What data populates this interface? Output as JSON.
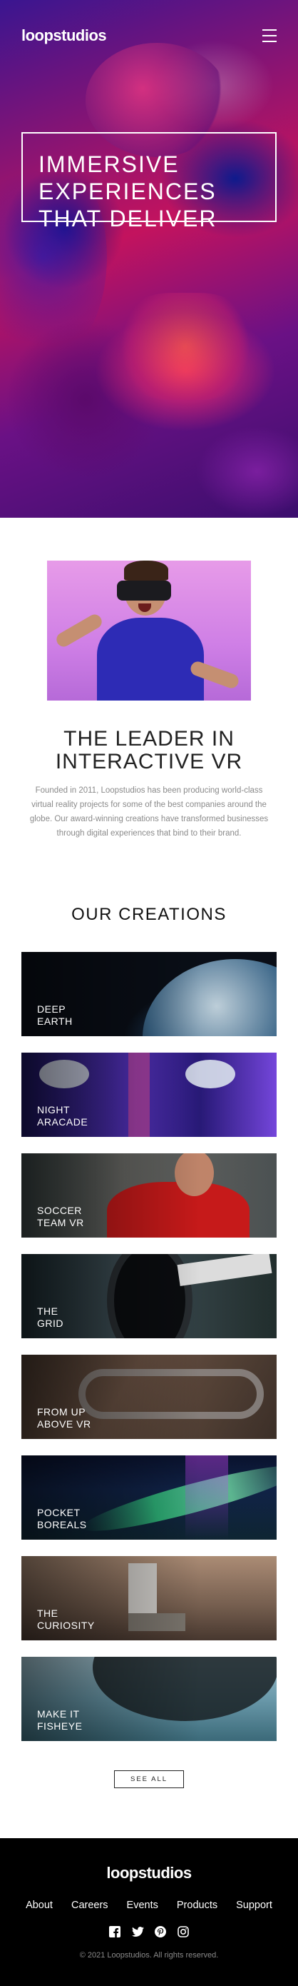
{
  "header": {
    "logo": "loopstudios",
    "menu_icon": "hamburger-menu-icon"
  },
  "hero": {
    "title": "IMMERSIVE\nEXPERIENCES\nTHAT DELIVER"
  },
  "about": {
    "title": "THE LEADER IN\nINTERACTIVE VR",
    "text": "Founded in 2011, Loopstudios has been producing world-class virtual reality projects for some of the best companies around the globe. Our award-winning creations have transformed businesses through digital experiences that bind to their brand."
  },
  "creations": {
    "title": "OUR CREATIONS",
    "items": [
      {
        "label": "DEEP\nEARTH"
      },
      {
        "label": "NIGHT\nARACADE"
      },
      {
        "label": "SOCCER\nTEAM VR"
      },
      {
        "label": "THE\nGRID"
      },
      {
        "label": "FROM UP\nABOVE VR"
      },
      {
        "label": "POCKET\nBOREALS"
      },
      {
        "label": "THE\nCURIOSITY"
      },
      {
        "label": "MAKE IT\nFISHEYE"
      }
    ],
    "see_all": "SEE ALL"
  },
  "footer": {
    "logo": "loopstudios",
    "nav": [
      "About",
      "Careers",
      "Events",
      "Products",
      "Support"
    ],
    "social_icons": [
      "facebook-icon",
      "twitter-icon",
      "pinterest-icon",
      "instagram-icon"
    ],
    "copyright": "© 2021 Loopstudios. All rights reserved."
  }
}
